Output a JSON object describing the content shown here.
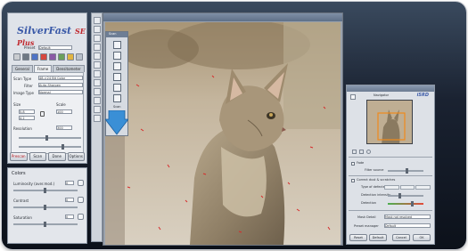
{
  "colors": {
    "brand_blue": "#3b5aa8",
    "brand_red": "#c0282d",
    "accent_arrow": "#3a8fd6",
    "window_bg": "#1a2231"
  },
  "app": {
    "brand_name": "SilverFast",
    "brand_suffix": "SE Plus"
  },
  "main_panel": {
    "preset_label": "Preset",
    "preset_value": "Default",
    "tabs": [
      {
        "label": "General",
        "active": false
      },
      {
        "label": "Frame",
        "active": true
      },
      {
        "label": "Densitometer",
        "active": false
      }
    ],
    "scan_type_label": "Scan Type",
    "scan_type_value": "48->24 Bit Color",
    "filter_label": "Filter",
    "filter_value": "Auto-Sharpen",
    "image_type_label": "Image Type",
    "image_type_value": "Normal",
    "scale_label": "Scale",
    "size_label": "Size",
    "scale_value": "100",
    "width_value": "5.8",
    "height_value": "4.2",
    "resolution_label": "Resolution",
    "resolution_value": "300",
    "buttons": [
      {
        "label": "Prescan",
        "hot": true
      },
      {
        "label": "Scan",
        "hot": false
      },
      {
        "label": "Done",
        "hot": false
      },
      {
        "label": "Options",
        "hot": false
      }
    ]
  },
  "color_panel": {
    "title": "Colors",
    "rows": [
      {
        "label": "Luminosity (aver.mod.)",
        "value": "0"
      },
      {
        "label": "Contrast",
        "value": "0"
      },
      {
        "label": "Saturation",
        "value": "0"
      }
    ]
  },
  "preview": {
    "title": ""
  },
  "palette": {
    "title": "Scan",
    "scan_label": "Scan"
  },
  "navigator": {
    "title": "Navigator",
    "brand": "iSRD",
    "checkbox1": "Fade",
    "slider1_label": "Filter source",
    "section2": "Correct dust & scratches",
    "type_label": "Type of defects",
    "slider_labels": [
      "Filter source",
      "Detection intensity",
      "Detection"
    ],
    "mask_label": "Mask Detail",
    "mask_value": "Mask not resolved",
    "preset_label": "Preset manager",
    "preset_value": "Default",
    "buttons": [
      "Reset",
      "Default",
      "Cancel",
      "OK"
    ]
  }
}
